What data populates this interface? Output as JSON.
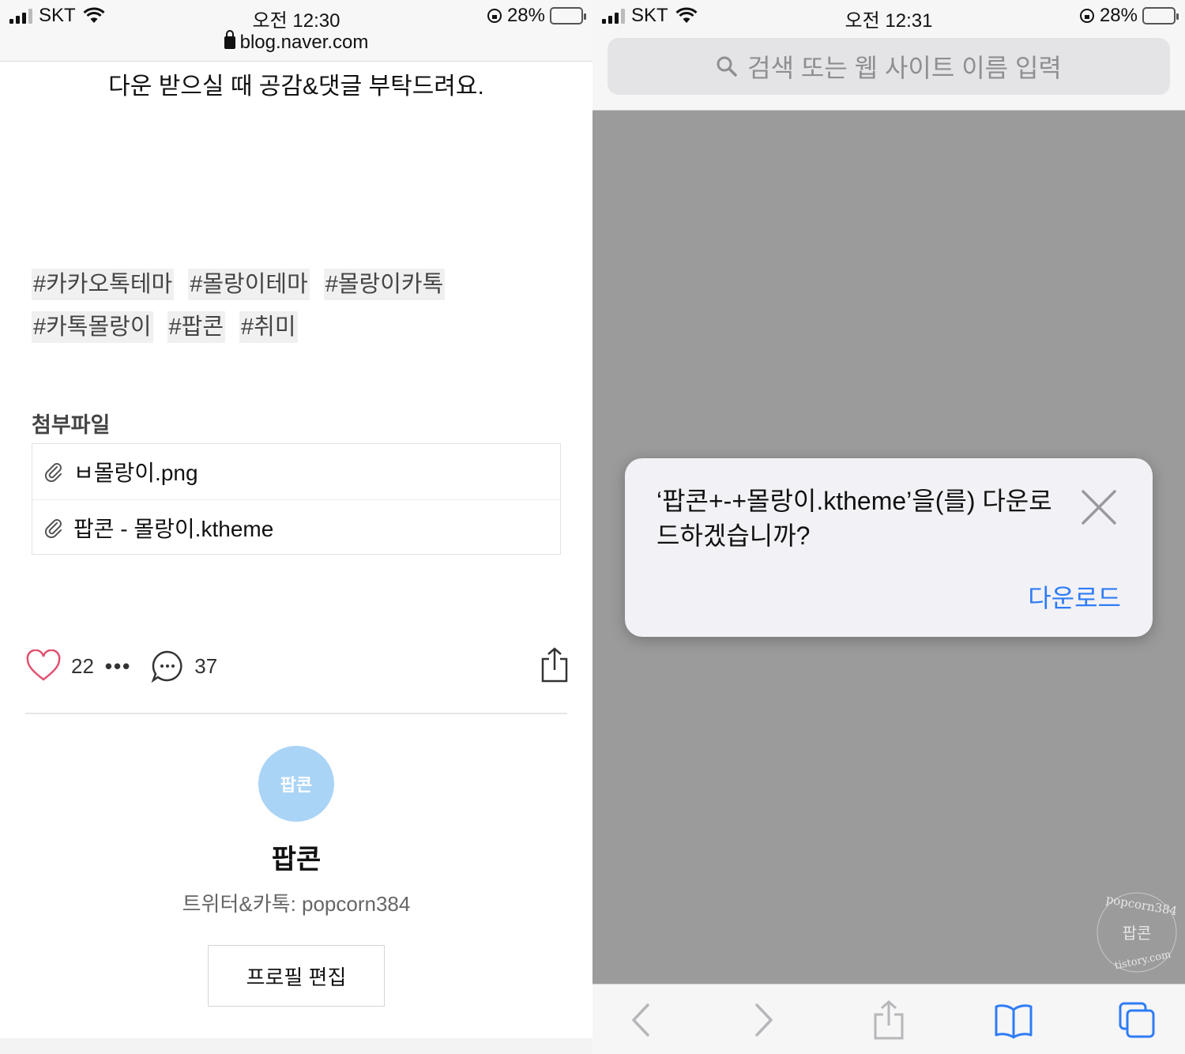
{
  "left": {
    "status": {
      "carrier": "SKT",
      "time": "오전 12:30",
      "battery": "28%"
    },
    "url": "blog.naver.com",
    "intro_text": "다운 받으실 때 공감&댓글 부탁드려요.",
    "tags": [
      "#카카오톡테마",
      "#몰랑이테마",
      "#몰랑이카톡",
      "#카톡몰랑이",
      "#팝콘",
      "#취미"
    ],
    "attachments": {
      "title": "첨부파일",
      "files": [
        "ㅂ몰랑이.png",
        "팝콘 - 몰랑이.ktheme"
      ]
    },
    "actions": {
      "likes": "22",
      "comments": "37"
    },
    "profile": {
      "avatar_text": "팝콘",
      "name": "팝콘",
      "description": "트위터&카톡: popcorn384",
      "edit_button": "프로필 편집"
    }
  },
  "right": {
    "status": {
      "carrier": "SKT",
      "time": "오전 12:31",
      "battery": "28%"
    },
    "search_placeholder": "검색 또는 웹 사이트 이름 입력",
    "dialog": {
      "message": "‘팝콘+-+몰랑이.ktheme’을(를) 다운로드하겠습니까?",
      "download_button": "다운로드"
    },
    "watermark": {
      "line1": "popcorn384",
      "line2": "팝콘",
      "line3": "tistory.com"
    }
  },
  "colors": {
    "accent_blue": "#2f7cf6",
    "like_pink": "#e0506f",
    "avatar_blue": "#aad4f6",
    "overlay_gray": "#9b9b9b"
  },
  "icons": [
    "lock-icon",
    "clip-icon",
    "heart-icon",
    "comment-icon",
    "share-icon",
    "search-icon",
    "close-icon",
    "back-icon",
    "forward-icon",
    "bookmarks-icon",
    "tabs-icon",
    "wifi-icon",
    "battery-icon"
  ]
}
